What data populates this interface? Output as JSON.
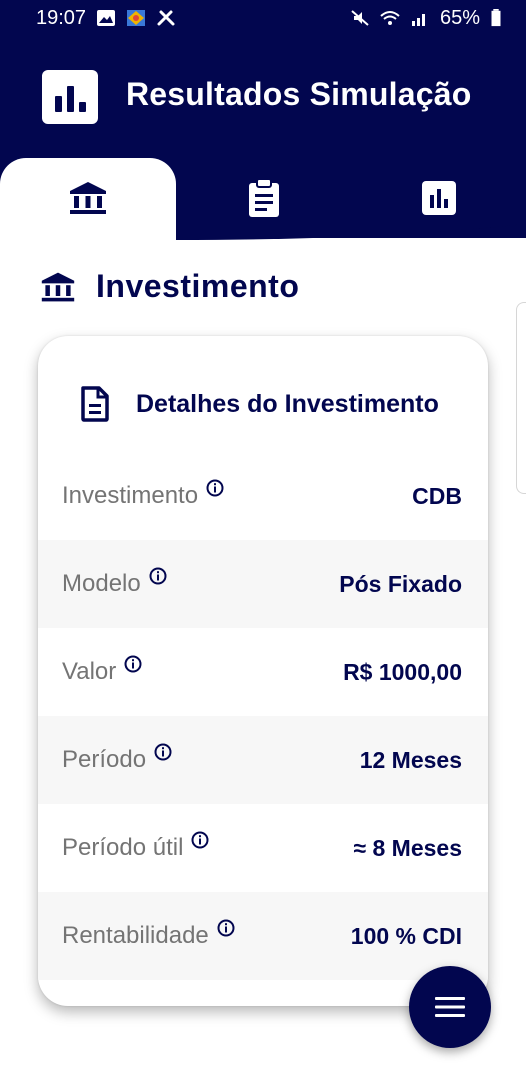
{
  "status_bar": {
    "time": "19:07",
    "battery": "65%"
  },
  "header": {
    "title": "Resultados Simulação"
  },
  "tabs": [
    {
      "icon": "bank-icon",
      "active": true
    },
    {
      "icon": "clipboard-icon",
      "active": false
    },
    {
      "icon": "bar-chart-icon",
      "active": false
    }
  ],
  "section": {
    "title": "Investimento",
    "icon": "bank-icon"
  },
  "card": {
    "title": "Detalhes do Investimento",
    "rows": [
      {
        "label": "Investimento",
        "value": "CDB"
      },
      {
        "label": "Modelo",
        "value": "Pós Fixado"
      },
      {
        "label": "Valor",
        "value": "R$ 1000,00"
      },
      {
        "label": "Período",
        "value": "12 Meses"
      },
      {
        "label": "Período útil",
        "value": "≈ 8 Meses"
      },
      {
        "label": "Rentabilidade",
        "value": "100 % CDI"
      }
    ]
  },
  "fab": {
    "icon": "menu-icon"
  },
  "colors": {
    "primary": "#02064f",
    "label": "#747474",
    "row_alt": "#f7f7f7"
  }
}
